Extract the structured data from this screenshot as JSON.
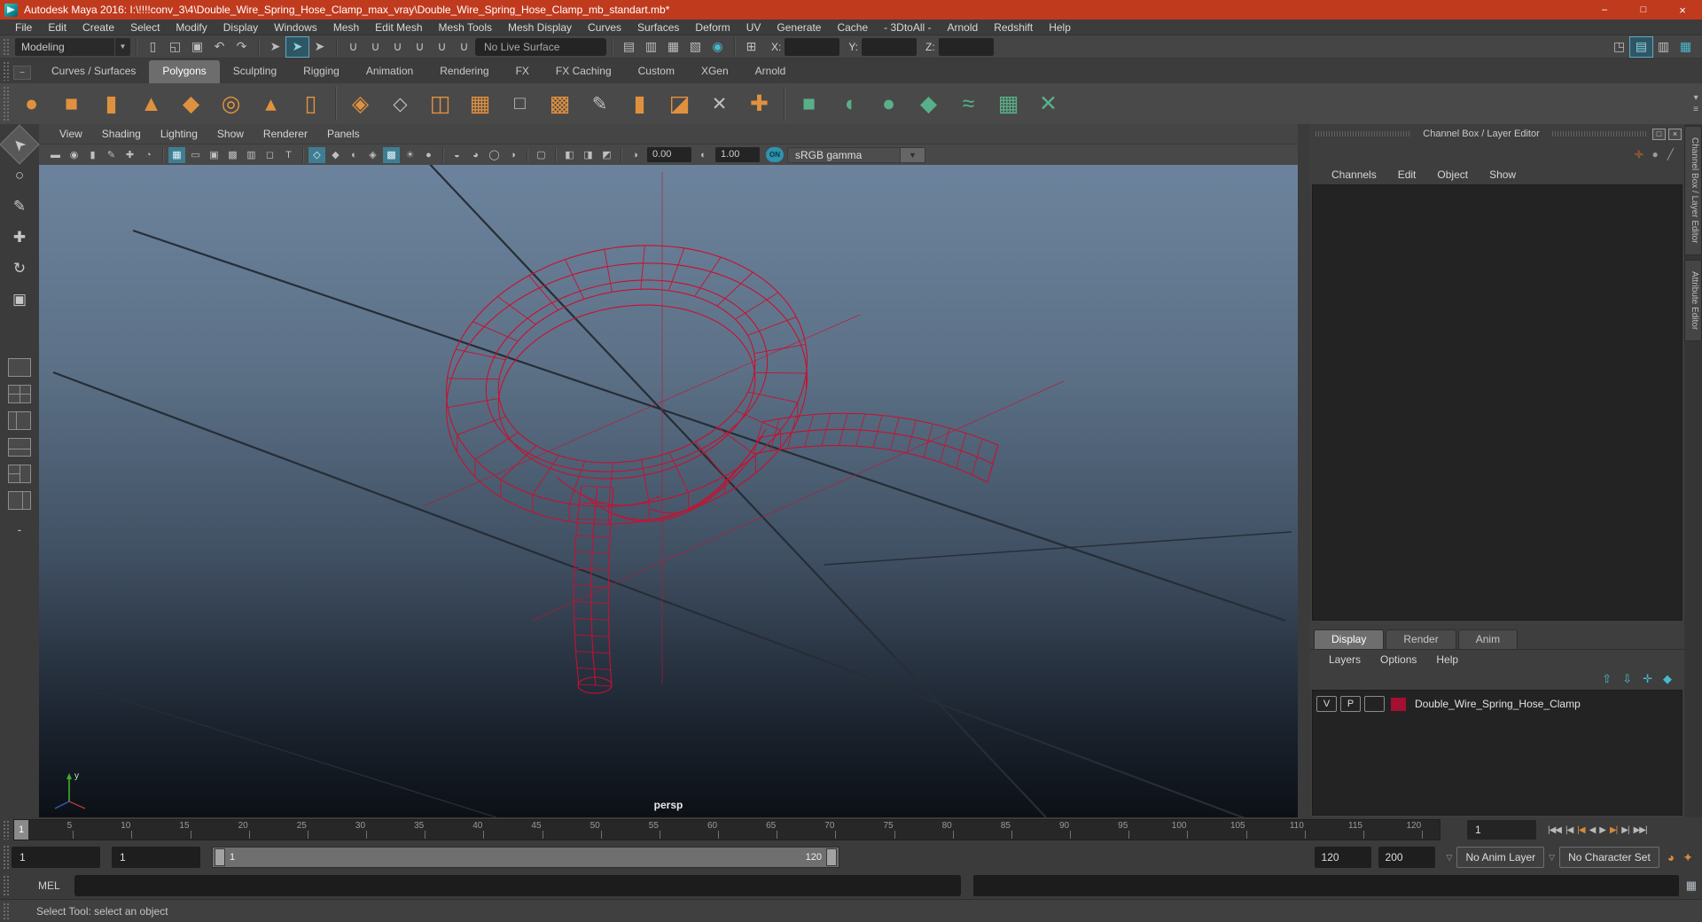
{
  "window": {
    "title": "Autodesk Maya 2016: I:\\!!!!conv_3\\4\\Double_Wire_Spring_Hose_Clamp_max_vray\\Double_Wire_Spring_Hose_Clamp_mb_standart.mb*",
    "minimize_icon": "–",
    "maximize_icon": "□",
    "close_icon": "×"
  },
  "menubar": {
    "items": [
      "File",
      "Edit",
      "Create",
      "Select",
      "Modify",
      "Display",
      "Windows",
      "Mesh",
      "Edit Mesh",
      "Mesh Tools",
      "Mesh Display",
      "Curves",
      "Surfaces",
      "Deform",
      "UV",
      "Generate",
      "Cache",
      "- 3DtoAll -",
      "Arnold",
      "Redshift",
      "Help"
    ]
  },
  "toolbar": {
    "mode": "Modeling",
    "live_surface": "No Live Surface",
    "x_label": "X:",
    "y_label": "Y:",
    "z_label": "Z:",
    "x_value": "",
    "y_value": "",
    "z_value": "",
    "file_icons": [
      {
        "n": "new-scene-icon",
        "g": "▯"
      },
      {
        "n": "open-scene-icon",
        "g": "◱"
      },
      {
        "n": "save-scene-icon",
        "g": "▣"
      }
    ],
    "undo_icons": [
      {
        "n": "undo-icon",
        "g": "↶"
      },
      {
        "n": "redo-icon",
        "g": "↷"
      }
    ],
    "select_icons": [
      {
        "n": "select-hierarchy-icon",
        "g": "➤"
      },
      {
        "n": "select-object-icon",
        "g": "➤",
        "active": true
      },
      {
        "n": "select-component-icon",
        "g": "➤"
      }
    ],
    "snap_icons": [
      {
        "n": "snap-to-grid-icon",
        "g": "∪"
      },
      {
        "n": "snap-to-curve-icon",
        "g": "∪"
      },
      {
        "n": "snap-to-point-icon",
        "g": "∪"
      },
      {
        "n": "snap-to-projected-center-icon",
        "g": "∪"
      },
      {
        "n": "snap-to-view-plane-icon",
        "g": "∪"
      },
      {
        "n": "make-live-icon",
        "g": "∪"
      }
    ],
    "history_icons": [
      {
        "n": "open-render-view-icon",
        "g": "▤"
      },
      {
        "n": "render-current-frame-icon",
        "g": "▥"
      },
      {
        "n": "ipr-render-icon",
        "g": "▦"
      },
      {
        "n": "render-settings-icon",
        "g": "▧"
      },
      {
        "n": "hypershade-icon",
        "g": "◉",
        "cls": "teal"
      }
    ],
    "target_icon": [
      {
        "n": "grid-target-icon",
        "g": "⊞"
      }
    ],
    "sidebar_icons": [
      {
        "n": "modeling-toolkit-icon",
        "g": "◳"
      },
      {
        "n": "attribute-editor-icon",
        "g": "▤",
        "active": true
      },
      {
        "n": "tool-settings-icon",
        "g": "▥"
      },
      {
        "n": "channel-box-icon",
        "g": "▦",
        "cls": "teal"
      }
    ]
  },
  "shelf": {
    "active_tab": "Polygons",
    "tabs": [
      "Curves / Surfaces",
      "Polygons",
      "Sculpting",
      "Rigging",
      "Animation",
      "Rendering",
      "FX",
      "FX Caching",
      "Custom",
      "XGen",
      "Arnold"
    ],
    "primitive_icons": [
      {
        "n": "poly-sphere-icon",
        "g": "●",
        "cls": "orange"
      },
      {
        "n": "poly-cube-icon",
        "g": "■",
        "cls": "orange"
      },
      {
        "n": "poly-cylinder-icon",
        "g": "▮",
        "cls": "orange"
      },
      {
        "n": "poly-cone-icon",
        "g": "▲",
        "cls": "orange"
      },
      {
        "n": "poly-plane-icon",
        "g": "◆",
        "cls": "orange"
      },
      {
        "n": "poly-torus-icon",
        "g": "◎",
        "cls": "orange"
      },
      {
        "n": "poly-pyramid-icon",
        "g": "▴",
        "cls": "orange"
      },
      {
        "n": "poly-pipe-icon",
        "g": "▯",
        "cls": "orange"
      }
    ],
    "edit_icons": [
      {
        "n": "combine-icon",
        "g": "◈",
        "cls": "orange"
      },
      {
        "n": "separate-icon",
        "g": "◇",
        "cls": "gray"
      },
      {
        "n": "split-icon",
        "g": "◫",
        "cls": "orange"
      },
      {
        "n": "smooth-icon",
        "g": "▦",
        "cls": "orange"
      },
      {
        "n": "subdiv-proxy-icon",
        "g": "□",
        "cls": "gray"
      },
      {
        "n": "reduce-icon",
        "g": "▩",
        "cls": "orange"
      },
      {
        "n": "crease-tool-icon",
        "g": "✎",
        "cls": "gray"
      },
      {
        "n": "extrude-icon",
        "g": "▮",
        "cls": "orange"
      },
      {
        "n": "bevel-icon",
        "g": "◪",
        "cls": "orange"
      },
      {
        "n": "multi-cut-icon",
        "g": "✕",
        "cls": "gray"
      },
      {
        "n": "target-weld-icon",
        "g": "✚",
        "cls": "orange"
      }
    ],
    "uv_icons": [
      {
        "n": "planar-mapping-icon",
        "g": "■",
        "cls": "green"
      },
      {
        "n": "cylindrical-mapping-icon",
        "g": "◖",
        "cls": "green"
      },
      {
        "n": "spherical-mapping-icon",
        "g": "●",
        "cls": "green"
      },
      {
        "n": "automatic-mapping-icon",
        "g": "◆",
        "cls": "green"
      },
      {
        "n": "contour-stretch-icon",
        "g": "≈",
        "cls": "green"
      },
      {
        "n": "uv-editor-icon",
        "g": "▦",
        "cls": "green"
      },
      {
        "n": "cut-sew-uv-icon",
        "g": "✕",
        "cls": "green"
      }
    ]
  },
  "toolbox": {
    "tools": [
      {
        "n": "select-tool-icon",
        "g": "➤",
        "cls": "rot225",
        "active": true
      },
      {
        "n": "lasso-tool-icon",
        "g": "○"
      },
      {
        "n": "paint-select-tool-icon",
        "g": "✎"
      },
      {
        "n": "move-tool-icon",
        "g": "✚"
      },
      {
        "n": "rotate-tool-icon",
        "g": "↻"
      },
      {
        "n": "scale-tool-icon",
        "g": "▣"
      }
    ],
    "layouts": [
      {
        "n": "single-pane-layout-button",
        "cls": "lay1"
      },
      {
        "n": "four-pane-layout-button",
        "cls": "lay4"
      },
      {
        "n": "persp-outliner-layout-button",
        "cls": "lay2v"
      },
      {
        "n": "persp-graph-layout-button",
        "cls": "lay2h"
      },
      {
        "n": "hypershade-persp-layout-button",
        "cls": "lay3"
      },
      {
        "n": "uv-persp-layout-button",
        "cls": "lay2v2"
      }
    ],
    "collapse_label": "-"
  },
  "viewport": {
    "menus": [
      "View",
      "Shading",
      "Lighting",
      "Show",
      "Renderer",
      "Panels"
    ],
    "icons": [
      {
        "n": "select-camera-icon",
        "g": "▬"
      },
      {
        "n": "camera-attributes-icon",
        "g": "◉"
      },
      {
        "n": "bookmark-icon",
        "g": "▮"
      },
      {
        "n": "image-plane-icon",
        "g": "✎"
      },
      {
        "n": "2d-pan-zoom-icon",
        "g": "✚"
      },
      {
        "n": "grease-pencil-icon",
        "g": "◔"
      },
      {
        "sep": true
      },
      {
        "n": "grid-icon",
        "g": "▦",
        "active": true
      },
      {
        "n": "film-gate-icon",
        "g": "▭"
      },
      {
        "n": "resolution-gate-icon",
        "g": "▣"
      },
      {
        "n": "gate-mask-icon",
        "g": "▩"
      },
      {
        "n": "field-chart-icon",
        "g": "▥"
      },
      {
        "n": "safe-action-icon",
        "g": "◻"
      },
      {
        "n": "safe-title-icon",
        "g": "T"
      },
      {
        "sep": true
      },
      {
        "n": "wireframe-on-shaded-icon",
        "g": "◇",
        "active": true
      },
      {
        "n": "smooth-shade-icon",
        "g": "◆"
      },
      {
        "n": "flat-shade-icon",
        "g": "◐"
      },
      {
        "n": "bounding-box-icon",
        "g": "◈"
      },
      {
        "n": "textured-icon",
        "g": "▩",
        "active": true
      },
      {
        "n": "use-lights-icon",
        "g": "☀"
      },
      {
        "n": "shadows-icon",
        "g": "●"
      },
      {
        "sep": true
      },
      {
        "n": "occlusion-icon",
        "g": "◒"
      },
      {
        "n": "motion-blur-icon",
        "g": "◕"
      },
      {
        "n": "multisample-icon",
        "g": "◯"
      },
      {
        "n": "depth-of-field-icon",
        "g": "◑"
      },
      {
        "sep": true
      },
      {
        "n": "isolate-select-icon",
        "g": "▢"
      },
      {
        "sep": true
      },
      {
        "n": "xray-icon",
        "g": "◧"
      },
      {
        "n": "xray-joints-icon",
        "g": "◨"
      },
      {
        "n": "selection-highlight-icon",
        "g": "◩"
      }
    ],
    "exposure_icon": "◑",
    "exposure_value": "0.00",
    "contrast_icon": "◐",
    "gamma_value": "1.00",
    "on_toggle": "ON",
    "colorspace": "sRGB gamma",
    "camera_label": "persp",
    "axis_labels": {
      "y": "y"
    }
  },
  "channel_box": {
    "title": "Channel Box / Layer Editor",
    "restore_icon": "□",
    "close_icon": "×",
    "corner_icons": [
      {
        "n": "axis-tripod-icon",
        "g": "✛",
        "cls": "tripod"
      },
      {
        "n": "sphere-icon",
        "g": "●"
      },
      {
        "n": "slash-icon",
        "g": "╱"
      }
    ],
    "menus": [
      "Channels",
      "Edit",
      "Object",
      "Show"
    ],
    "side_tabs": [
      "Channel Box / Layer Editor",
      "Attribute Editor"
    ]
  },
  "layer_editor": {
    "tabs": [
      "Display",
      "Render",
      "Anim"
    ],
    "active_tab": "Display",
    "menus": [
      "Layers",
      "Options",
      "Help"
    ],
    "icons": [
      {
        "n": "move-layer-up-icon",
        "g": "⇧"
      },
      {
        "n": "move-layer-down-icon",
        "g": "⇩"
      },
      {
        "n": "add-layer-selected-icon",
        "g": "✛"
      },
      {
        "n": "add-empty-layer-icon",
        "g": "◆"
      }
    ],
    "layer": {
      "v_label": "V",
      "p_label": "P",
      "name": "Double_Wire_Spring_Hose_Clamp",
      "color": "#a50f31"
    }
  },
  "timeline": {
    "ticks": [
      5,
      10,
      15,
      20,
      25,
      30,
      35,
      40,
      45,
      50,
      55,
      60,
      65,
      70,
      75,
      80,
      85,
      90,
      95,
      100,
      105,
      110,
      115,
      120
    ],
    "playhead_frame": "1",
    "current_frame_field": "1",
    "transport": [
      {
        "n": "go-to-start-button",
        "g": "|◀◀"
      },
      {
        "n": "step-back-frame-button",
        "g": "|◀"
      },
      {
        "n": "step-back-key-button",
        "g": "|◀",
        "key": true
      },
      {
        "n": "play-backwards-button",
        "g": "◀"
      },
      {
        "n": "play-forwards-button",
        "g": "▶"
      },
      {
        "n": "step-forward-key-button",
        "g": "▶|",
        "key": true
      },
      {
        "n": "step-forward-frame-button",
        "g": "▶|"
      },
      {
        "n": "go-to-end-button",
        "g": "▶▶|"
      }
    ]
  },
  "range_slider": {
    "field_start": "1",
    "field_anim_start": "1",
    "bar_start_label": "1",
    "bar_end_label": "120",
    "field_end": "120",
    "field_anim_end": "200",
    "anim_layer": "No Anim Layer",
    "character_set": "No Character Set",
    "icons": [
      {
        "n": "auto-keyframe-icon",
        "g": "◕"
      },
      {
        "n": "animation-preferences-icon",
        "g": "✦"
      }
    ]
  },
  "command_line": {
    "label": "MEL",
    "value": ""
  },
  "help_line": {
    "text": "Select Tool: select an object"
  },
  "colors": {
    "titlebar": "#c03a1e",
    "wireframe": "#c81030",
    "accent_teal": "#49b8cc",
    "shelf_orange": "#e0913f",
    "shelf_green": "#58b088",
    "layer_swatch": "#a50f31"
  }
}
